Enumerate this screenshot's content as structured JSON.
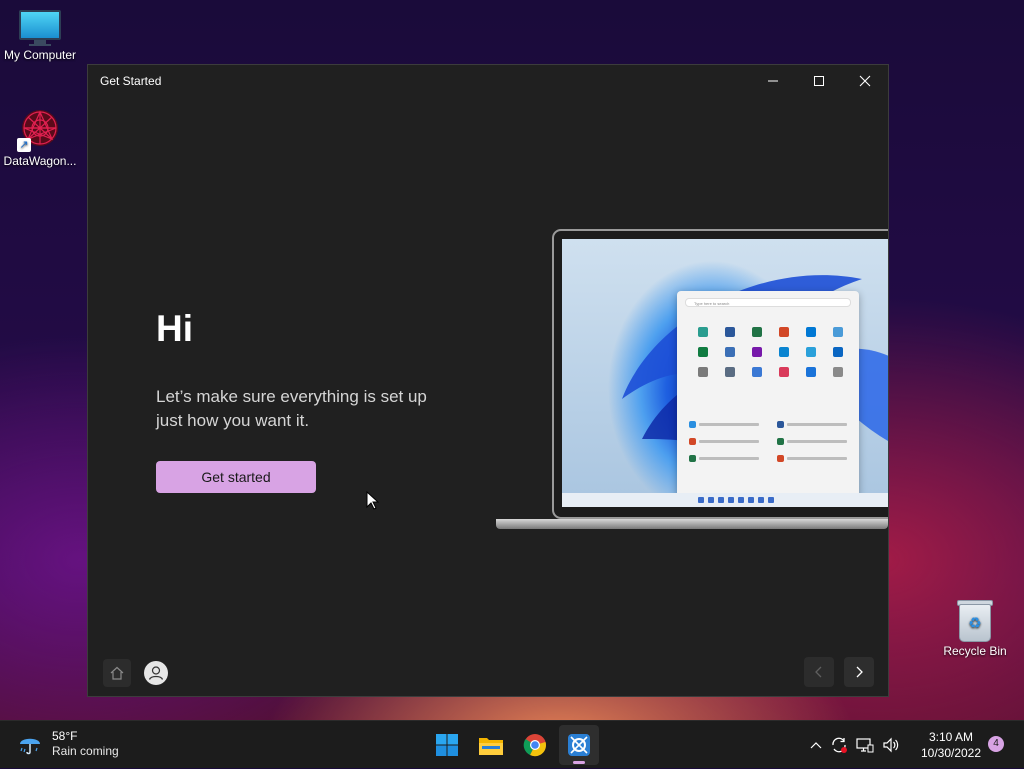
{
  "desktop": {
    "icons": [
      {
        "label": "My Computer"
      },
      {
        "label": "DataWagon..."
      },
      {
        "label": "Recycle Bin"
      }
    ]
  },
  "window": {
    "title": "Get Started",
    "heading": "Hi",
    "description": "Let’s make sure everything is set up just how you want it.",
    "primary_button": "Get started"
  },
  "illustration": {
    "search_placeholder": "Type here to search"
  },
  "taskbar": {
    "weather_temp": "58°F",
    "weather_text": "Rain coming",
    "time": "3:10 AM",
    "date": "10/30/2022",
    "notification_count": "4",
    "accent_color": "#d8a3e4"
  }
}
